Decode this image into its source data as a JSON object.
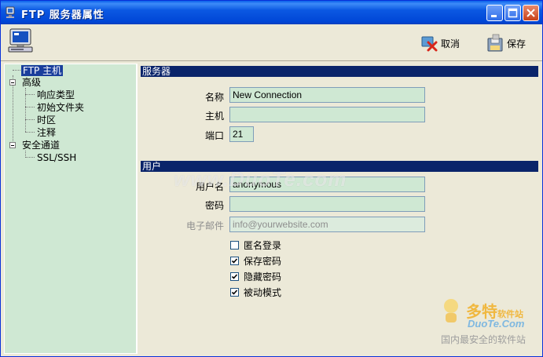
{
  "window": {
    "title": "FTP 服务器属性"
  },
  "toolbar": {
    "cancel_label": "取消",
    "save_label": "保存"
  },
  "tree": {
    "items": [
      {
        "label": "FTP 主机"
      },
      {
        "label": "高级"
      },
      {
        "label": "响应类型"
      },
      {
        "label": "初始文件夹"
      },
      {
        "label": "时区"
      },
      {
        "label": "注释"
      },
      {
        "label": "安全通道"
      },
      {
        "label": "SSL/SSH"
      }
    ]
  },
  "server_section": {
    "header": "服务器",
    "name_label": "名称",
    "name_value": "New Connection",
    "host_label": "主机",
    "host_value": "",
    "port_label": "端口",
    "port_value": "21"
  },
  "user_section": {
    "header": "用户",
    "username_label": "用户名",
    "username_value": "anonymous",
    "password_label": "密码",
    "password_value": "",
    "email_label": "电子邮件",
    "email_value": "info@yourwebsite.com",
    "options": [
      {
        "label": "匿名登录",
        "checked": false
      },
      {
        "label": "保存密码",
        "checked": true
      },
      {
        "label": "隐藏密码",
        "checked": true
      },
      {
        "label": "被动模式",
        "checked": true
      }
    ]
  },
  "watermark": {
    "text": "www.DuoTe.com"
  },
  "brand": {
    "name": "多特",
    "tag": "软件站",
    "site": "DuoTe.Com",
    "slogan": "国内最安全的软件站"
  },
  "colors": {
    "title_bar": "#0046D6",
    "section_header": "#0A246A",
    "field_bg": "#CFE8D3",
    "window_bg": "#ECE9D8"
  }
}
